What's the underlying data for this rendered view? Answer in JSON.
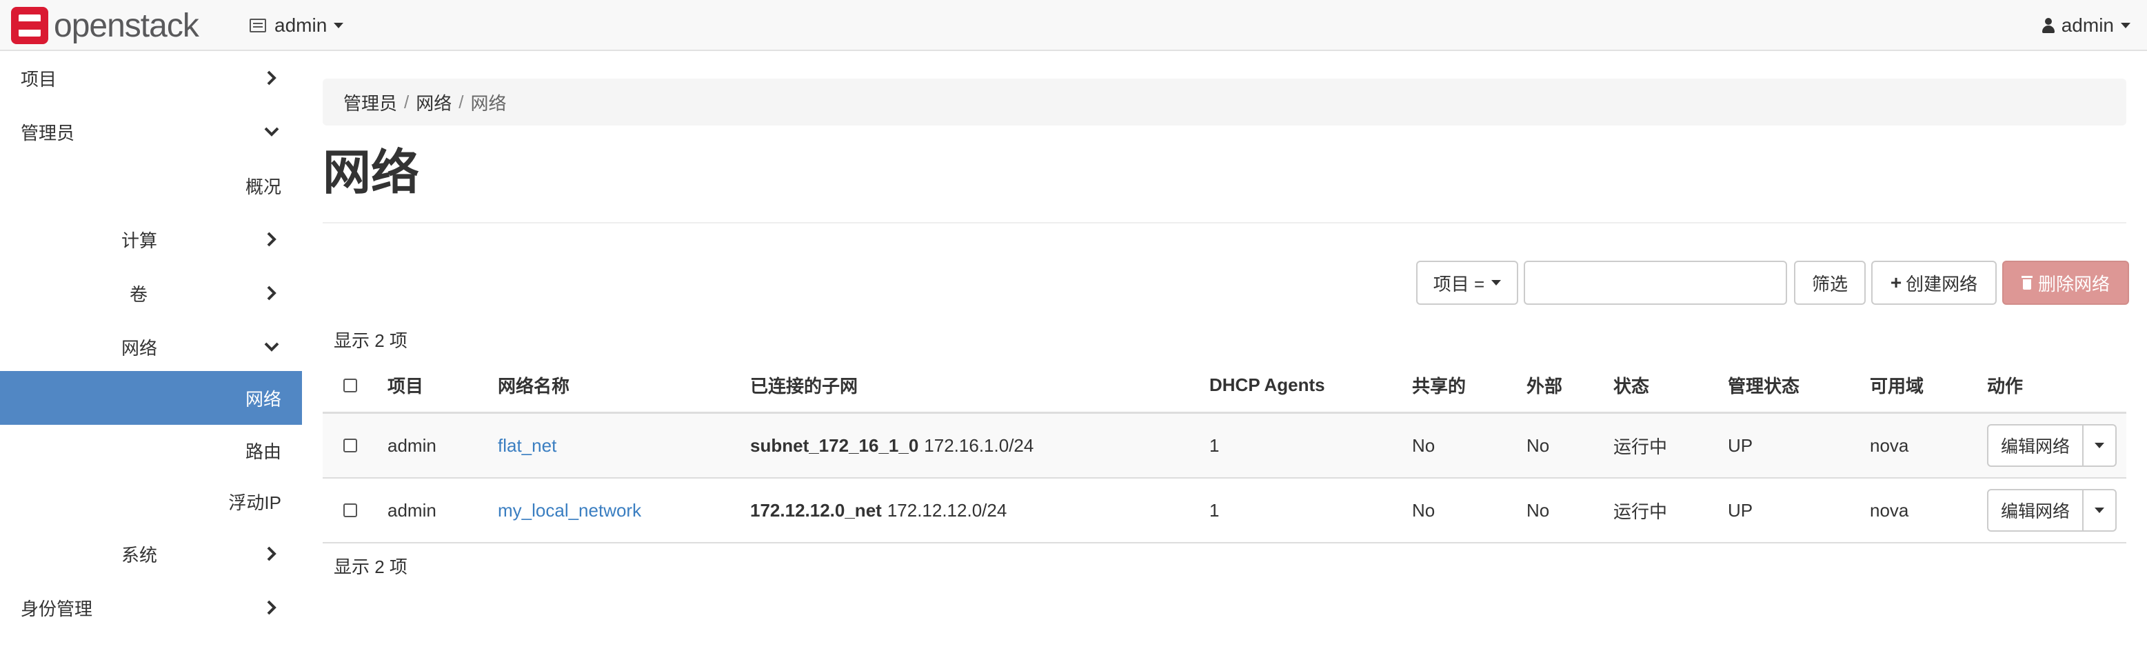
{
  "brand": {
    "name": "openstack",
    "logo_color": "#da1a32"
  },
  "topbar": {
    "project": "admin",
    "user": "admin"
  },
  "sidebar": {
    "items": [
      {
        "label": "项目",
        "chevron": "right"
      },
      {
        "label": "管理员",
        "chevron": "down"
      },
      {
        "label": "概况"
      },
      {
        "label": "计算",
        "chevron": "right"
      },
      {
        "label": "卷",
        "chevron": "right"
      },
      {
        "label": "网络",
        "chevron": "down"
      },
      {
        "label": "网络",
        "active": true
      },
      {
        "label": "路由"
      },
      {
        "label": "浮动IP"
      },
      {
        "label": "系统",
        "chevron": "right"
      },
      {
        "label": "身份管理",
        "chevron": "right"
      }
    ],
    "active_color": "#5187c4"
  },
  "breadcrumb": [
    "管理员",
    "网络",
    "网络"
  ],
  "page_title": "网络",
  "toolbar": {
    "filter_type": "项目 =",
    "filter_value": "",
    "filter_button": "筛选",
    "create_button": "创建网络",
    "delete_button": "删除网络"
  },
  "count_text": "显示 2 项",
  "table": {
    "columns": [
      "项目",
      "网络名称",
      "已连接的子网",
      "DHCP Agents",
      "共享的",
      "外部",
      "状态",
      "管理状态",
      "可用域",
      "动作"
    ],
    "rows": [
      {
        "project": "admin",
        "name": "flat_net",
        "subnet_name": "subnet_172_16_1_0",
        "subnet_cidr": "172.16.1.0/24",
        "dhcp_agents": "1",
        "shared": "No",
        "external": "No",
        "status": "运行中",
        "admin_state": "UP",
        "zone": "nova",
        "action": "编辑网络"
      },
      {
        "project": "admin",
        "name": "my_local_network",
        "subnet_name": "172.12.12.0_net",
        "subnet_cidr": "172.12.12.0/24",
        "dhcp_agents": "1",
        "shared": "No",
        "external": "No",
        "status": "运行中",
        "admin_state": "UP",
        "zone": "nova",
        "action": "编辑网络"
      }
    ]
  },
  "colors": {
    "link": "#3a7ec1",
    "danger_disabled": "#dd9795"
  }
}
